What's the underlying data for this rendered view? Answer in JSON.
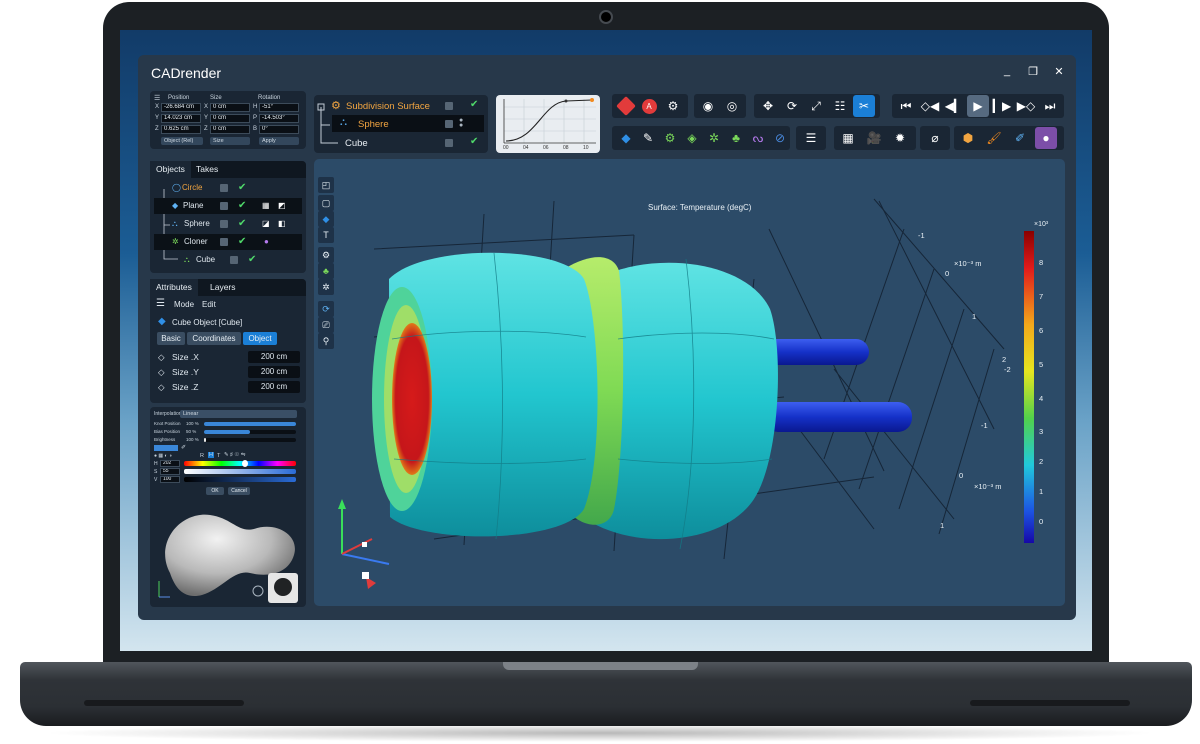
{
  "app": {
    "title": "CADrender"
  },
  "window": {
    "minimize": "_",
    "restore": "❐",
    "close": "✕"
  },
  "coords": {
    "headers": [
      "Position",
      "Size",
      "Rotation"
    ],
    "rows": [
      {
        "a": "X",
        "a_val": "-26.684 cm",
        "b": "X",
        "b_val": "0 cm",
        "c": "H",
        "c_val": "-51°"
      },
      {
        "a": "Y",
        "a_val": "14.023 cm",
        "b": "Y",
        "b_val": "0 cm",
        "c": "P",
        "c_val": "-14.503°"
      },
      {
        "a": "Z",
        "a_val": "0.625 cm",
        "b": "Z",
        "b_val": "0 cm",
        "c": "B",
        "c_val": "0°"
      }
    ],
    "dropdowns": [
      "Object (Rel)",
      "Size",
      "Apply"
    ]
  },
  "hierarchy": {
    "items": [
      "Subdivision Surface",
      "Sphere",
      "Cube"
    ],
    "accent": "#f2a541"
  },
  "curve": {
    "ticks": [
      "00",
      "04",
      "06",
      "08",
      "10"
    ]
  },
  "objects": {
    "tabs": [
      "Objects",
      "Takes"
    ],
    "items": [
      "Circle",
      "Plane",
      "Sphere",
      "Cloner",
      "Cube"
    ]
  },
  "attributes": {
    "tabs": [
      "Attributes",
      "Layers"
    ],
    "menu": [
      "Mode",
      "Edit"
    ],
    "object_title": "Cube Object [Cube]",
    "subtabs": [
      "Basic",
      "Coordinates",
      "Object"
    ],
    "sizes": [
      {
        "label": "Size .X",
        "value": "200 cm"
      },
      {
        "label": "Size .Y",
        "value": "200 cm"
      },
      {
        "label": "Size .Z",
        "value": "200 cm"
      }
    ]
  },
  "color_panel": {
    "interpolation_label": "Interpolation",
    "interpolation_value": "Linear",
    "sliders": [
      {
        "label": "Knot Position",
        "value": "100 %",
        "level": 1.0
      },
      {
        "label": "Bias Position",
        "value": "50 %",
        "level": 0.5
      },
      {
        "label": "Brightness",
        "value": "100 %",
        "level": 0.02
      }
    ],
    "mode_letters": [
      "R",
      "H",
      "T"
    ],
    "hsv": [
      {
        "label": "H",
        "value": "202"
      },
      {
        "label": "S",
        "value": "55"
      },
      {
        "label": "V",
        "value": "100"
      }
    ],
    "ok": "OK",
    "cancel": "Cancel"
  },
  "viewport": {
    "plot_title": "Surface: Temperature (degC)",
    "colorbar_multiplier": "×10³",
    "colorbar_ticks": [
      "8",
      "7",
      "6",
      "5",
      "4",
      "3",
      "2",
      "1",
      "0"
    ],
    "axis_unit_top": "×10⁻³ m",
    "axis_unit_bottom": "×10⁻³ m",
    "axis_ticks_top": [
      "-1",
      "0",
      "1",
      "2"
    ],
    "axis_ticks_bottom": [
      "-2",
      "-1",
      "0",
      "1"
    ]
  },
  "colors": {
    "app_bg": "#27384a",
    "panel_bg": "#1a2634",
    "viewport_bg": "#2c4b68",
    "accent_blue": "#1b7fd6",
    "check_green": "#4fd86a"
  }
}
